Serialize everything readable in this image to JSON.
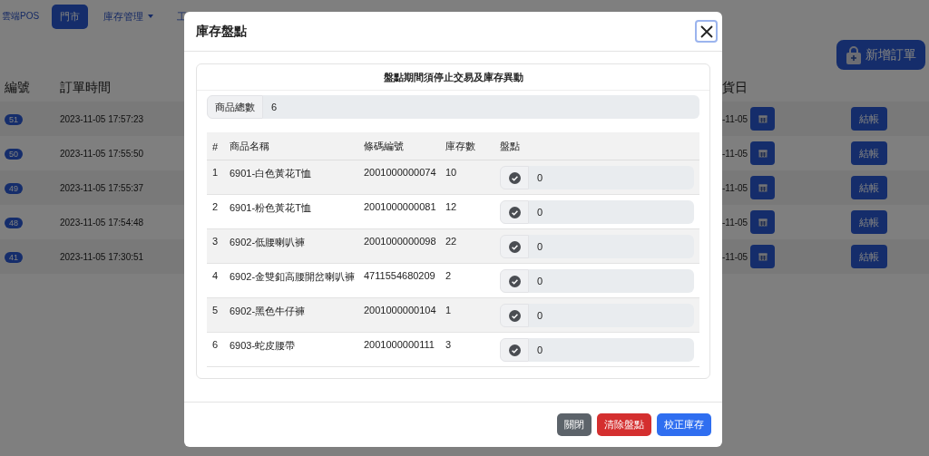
{
  "brand": "雲端POS",
  "nav": [
    {
      "label": "門市",
      "selected": true,
      "dropdown": false
    },
    {
      "label": "庫存管理",
      "selected": false,
      "dropdown": true
    },
    {
      "label": "工",
      "selected": false,
      "dropdown": false
    }
  ],
  "new_order_button": {
    "label": "新增訂單"
  },
  "orders": {
    "columns": [
      "編號",
      "訂單時間",
      "貨日"
    ],
    "rows": [
      {
        "id": "51",
        "time": "2023-11-05 17:57:23",
        "date": "-11-05",
        "action": "結帳"
      },
      {
        "id": "50",
        "time": "2023-11-05 17:55:50",
        "date": "-11-05",
        "action": "結帳"
      },
      {
        "id": "49",
        "time": "2023-11-05 17:55:37",
        "date": "-11-05",
        "action": "結帳"
      },
      {
        "id": "48",
        "time": "2023-11-05 17:54:48",
        "date": "-11-05",
        "action": "結帳"
      },
      {
        "id": "41",
        "time": "2023-11-05 17:30:51",
        "date": "-11-05",
        "action": "結帳"
      }
    ]
  },
  "modal": {
    "title": "庫存盤點",
    "notice": "盤點期間須停止交易及庫存異動",
    "total": {
      "label": "商品總數",
      "value": "6"
    },
    "columns": [
      "#",
      "商品名稱",
      "條碼編號",
      "庫存數",
      "盤點"
    ],
    "items": [
      {
        "index": "1",
        "name": "6901-白色黃花T恤",
        "barcode": "2001000000074",
        "stock": "10",
        "count": "0"
      },
      {
        "index": "2",
        "name": "6901-粉色黃花T恤",
        "barcode": "2001000000081",
        "stock": "12",
        "count": "0"
      },
      {
        "index": "3",
        "name": "6902-低腰喇叭褲",
        "barcode": "2001000000098",
        "stock": "22",
        "count": "0"
      },
      {
        "index": "4",
        "name": "6902-金雙釦高腰開岔喇叭褲",
        "barcode": "4711554680209",
        "stock": "2",
        "count": "0"
      },
      {
        "index": "5",
        "name": "6902-黑色牛仔褲",
        "barcode": "2001000000104",
        "stock": "1",
        "count": "0"
      },
      {
        "index": "6",
        "name": "6903-蛇皮腰帶",
        "barcode": "2001000000111",
        "stock": "3",
        "count": "0"
      }
    ],
    "buttons": [
      {
        "label": "關閉",
        "kind": "secondary"
      },
      {
        "label": "清除盤點",
        "kind": "danger"
      },
      {
        "label": "校正庫存",
        "kind": "primary"
      }
    ]
  }
}
